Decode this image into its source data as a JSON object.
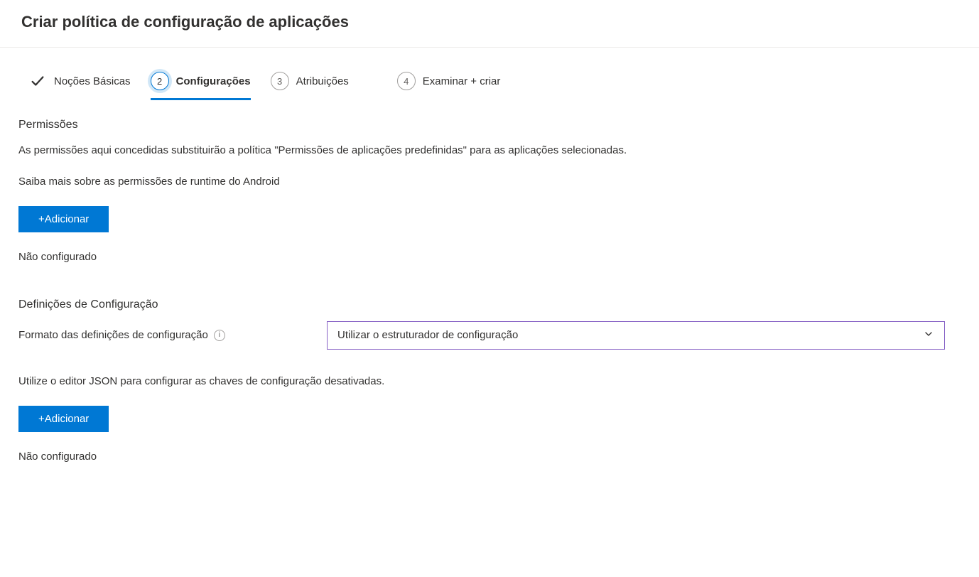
{
  "header": {
    "title": "Criar política de configuração de aplicações"
  },
  "stepper": {
    "step1": {
      "label": "Noções Básicas"
    },
    "step2": {
      "num": "2",
      "label": "Configurações"
    },
    "step3": {
      "num": "3",
      "label": "Atribuições"
    },
    "step4": {
      "num": "4",
      "label": "Examinar + criar"
    }
  },
  "permissions": {
    "title": "Permissões",
    "description": "As permissões aqui concedidas substituirão a política \"Permissões de aplicações predefinidas\" para as aplicações selecionadas.",
    "learn_more": "Saiba mais sobre as permissões de runtime do Android",
    "add_button": "+Adicionar",
    "status": "Não configurado"
  },
  "config": {
    "title": "Definições de Configuração",
    "format_label": "Formato das definições de configuração",
    "select_value": "Utilizar o estruturador de configuração",
    "helper": "Utilize o editor JSON para configurar as chaves de configuração desativadas.",
    "add_button": "+Adicionar",
    "status": "Não configurado"
  }
}
